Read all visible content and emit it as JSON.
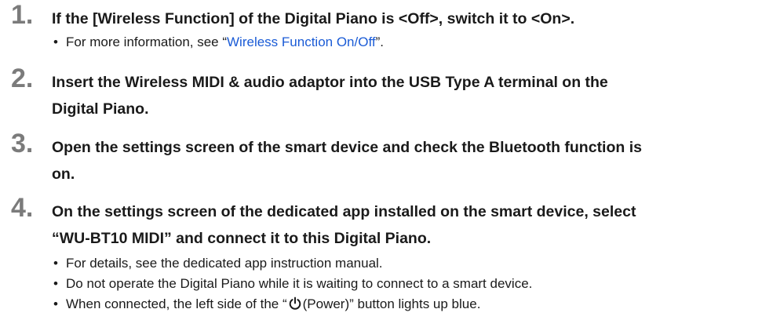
{
  "steps": [
    {
      "number": "1.",
      "title": "If the [Wireless Function] of the Digital Piano is <Off>, switch it to <On>.",
      "notes": [
        {
          "bullet": "•",
          "prefix": "For more information, see “",
          "link": "Wireless Function On/Off",
          "suffix": "”."
        }
      ]
    },
    {
      "number": "2.",
      "title_line1": "Insert the Wireless MIDI & audio adaptor into the USB Type A terminal on the",
      "title_line2": "Digital Piano."
    },
    {
      "number": "3.",
      "title_line1": "Open the settings screen of the smart device and check the Bluetooth function is",
      "title_line2": "on."
    },
    {
      "number": "4.",
      "title_line1": "On the settings screen of the dedicated app installed on the smart device, select",
      "title_line2": "“WU-BT10 MIDI” and connect it to this Digital Piano.",
      "notes": [
        {
          "bullet": "•",
          "text": "For details, see the dedicated app instruction manual."
        },
        {
          "bullet": "•",
          "text": "Do not operate the Digital Piano while it is waiting to connect to a smart device."
        },
        {
          "bullet": "•",
          "prefix": "When connected, the left side of the “",
          "icon": "power-icon",
          "suffix": "(Power)” button lights up blue."
        }
      ]
    }
  ]
}
